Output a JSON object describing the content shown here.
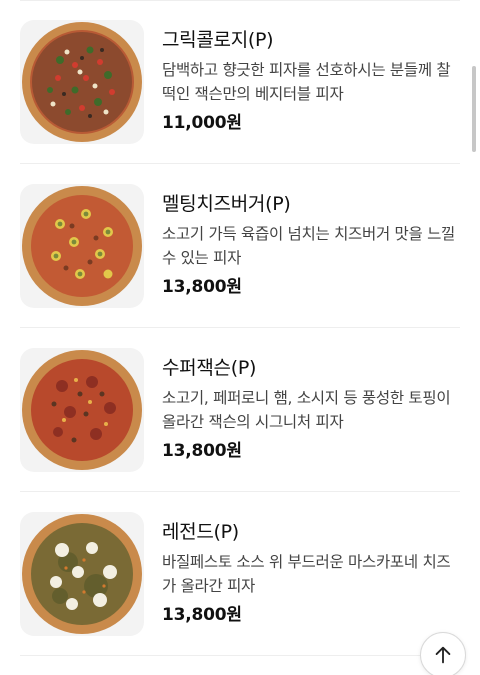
{
  "menu": {
    "items": [
      {
        "name": "그릭콜로지(P)",
        "description": "담백하고 향긋한 피자를 선호하시는 분들께 찰떡인 잭슨만의 베지터블 피자",
        "price": "11,000원",
        "image_icon": "greek-veggie-pizza-icon"
      },
      {
        "name": "멜팅치즈버거(P)",
        "description": "소고기 가득 육즙이 넘치는 치즈버거 맛을 느낄 수 있는 피자",
        "price": "13,800원",
        "image_icon": "cheeseburger-pizza-icon"
      },
      {
        "name": "수퍼잭슨(P)",
        "description": "소고기, 페퍼로니 햄, 소시지 등 풍성한 토핑이 올라간 잭슨의 시그니처 피자",
        "price": "13,800원",
        "image_icon": "supreme-pizza-icon"
      },
      {
        "name": "레전드(P)",
        "description": "바질페스토 소스 위 부드러운 마스카포네 치즈가 올라간 피자",
        "price": "13,800원",
        "image_icon": "basil-pesto-pizza-icon"
      }
    ]
  },
  "scroll_top_button": {
    "icon": "arrow-up-icon"
  },
  "colors": {
    "text_primary": "#111111",
    "text_secondary": "#444444",
    "divider": "#eeeeee",
    "crust": "#c98a4b",
    "sauce": "#b8492c"
  }
}
